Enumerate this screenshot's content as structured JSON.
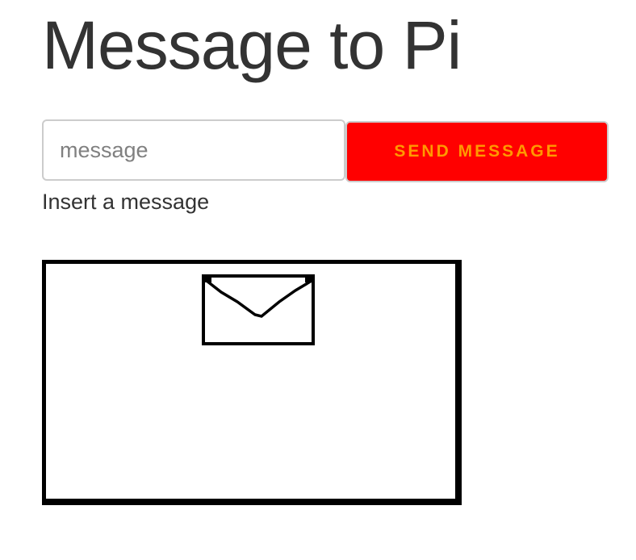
{
  "page": {
    "title": "Message to Pi"
  },
  "form": {
    "input_placeholder": "message",
    "input_value": "",
    "send_label": "SEND MESSAGE",
    "help_text": "Insert a message"
  },
  "preview": {
    "icon": "envelope-icon"
  },
  "colors": {
    "send_button_bg": "#ff0000",
    "send_button_text": "#ff9900",
    "title_text": "#333333"
  }
}
